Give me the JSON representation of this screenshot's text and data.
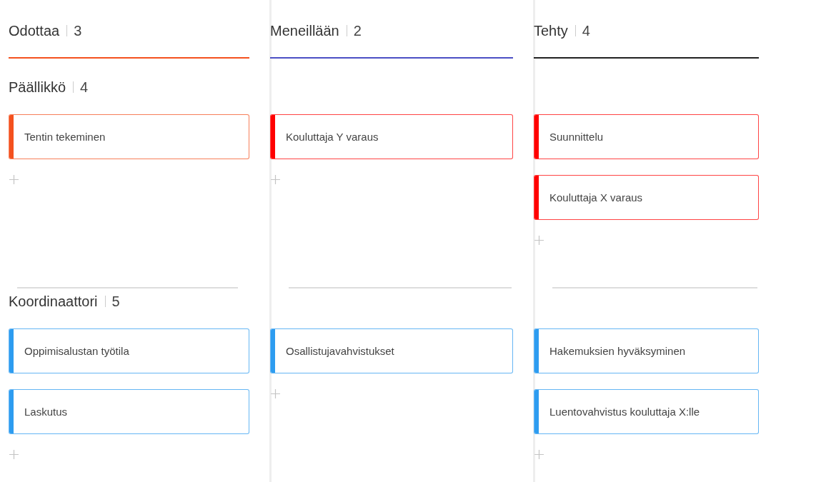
{
  "columns": [
    {
      "title": "Odottaa",
      "count": "3",
      "color": "#f4511e"
    },
    {
      "title": "Meneillään",
      "count": "2",
      "color": "#4c4fc4"
    },
    {
      "title": "Tehty",
      "count": "4",
      "color": "#222222"
    }
  ],
  "lanes": [
    {
      "title": "Päällikkö",
      "count": "4",
      "cells": [
        {
          "cards": [
            {
              "title": "Tentin tekeminen",
              "color": "#f4511e"
            }
          ]
        },
        {
          "cards": [
            {
              "title": "Kouluttaja Y varaus",
              "color": "#ff0000"
            }
          ]
        },
        {
          "cards": [
            {
              "title": "Suunnittelu",
              "color": "#ff0000"
            },
            {
              "title": "Kouluttaja X varaus",
              "color": "#ff0000"
            }
          ]
        }
      ]
    },
    {
      "title": "Koordinaattori",
      "count": "5",
      "cells": [
        {
          "cards": [
            {
              "title": "Oppimisalustan työtila",
              "color": "#2d9cf0"
            },
            {
              "title": "Laskutus",
              "color": "#2d9cf0"
            }
          ]
        },
        {
          "cards": [
            {
              "title": "Osallistujavahvistukset",
              "color": "#2d9cf0"
            }
          ]
        },
        {
          "cards": [
            {
              "title": "Hakemuksien hyväksyminen",
              "color": "#2d9cf0"
            },
            {
              "title": "Luentovahvistus kouluttaja X:lle",
              "color": "#2d9cf0"
            }
          ]
        }
      ]
    }
  ]
}
